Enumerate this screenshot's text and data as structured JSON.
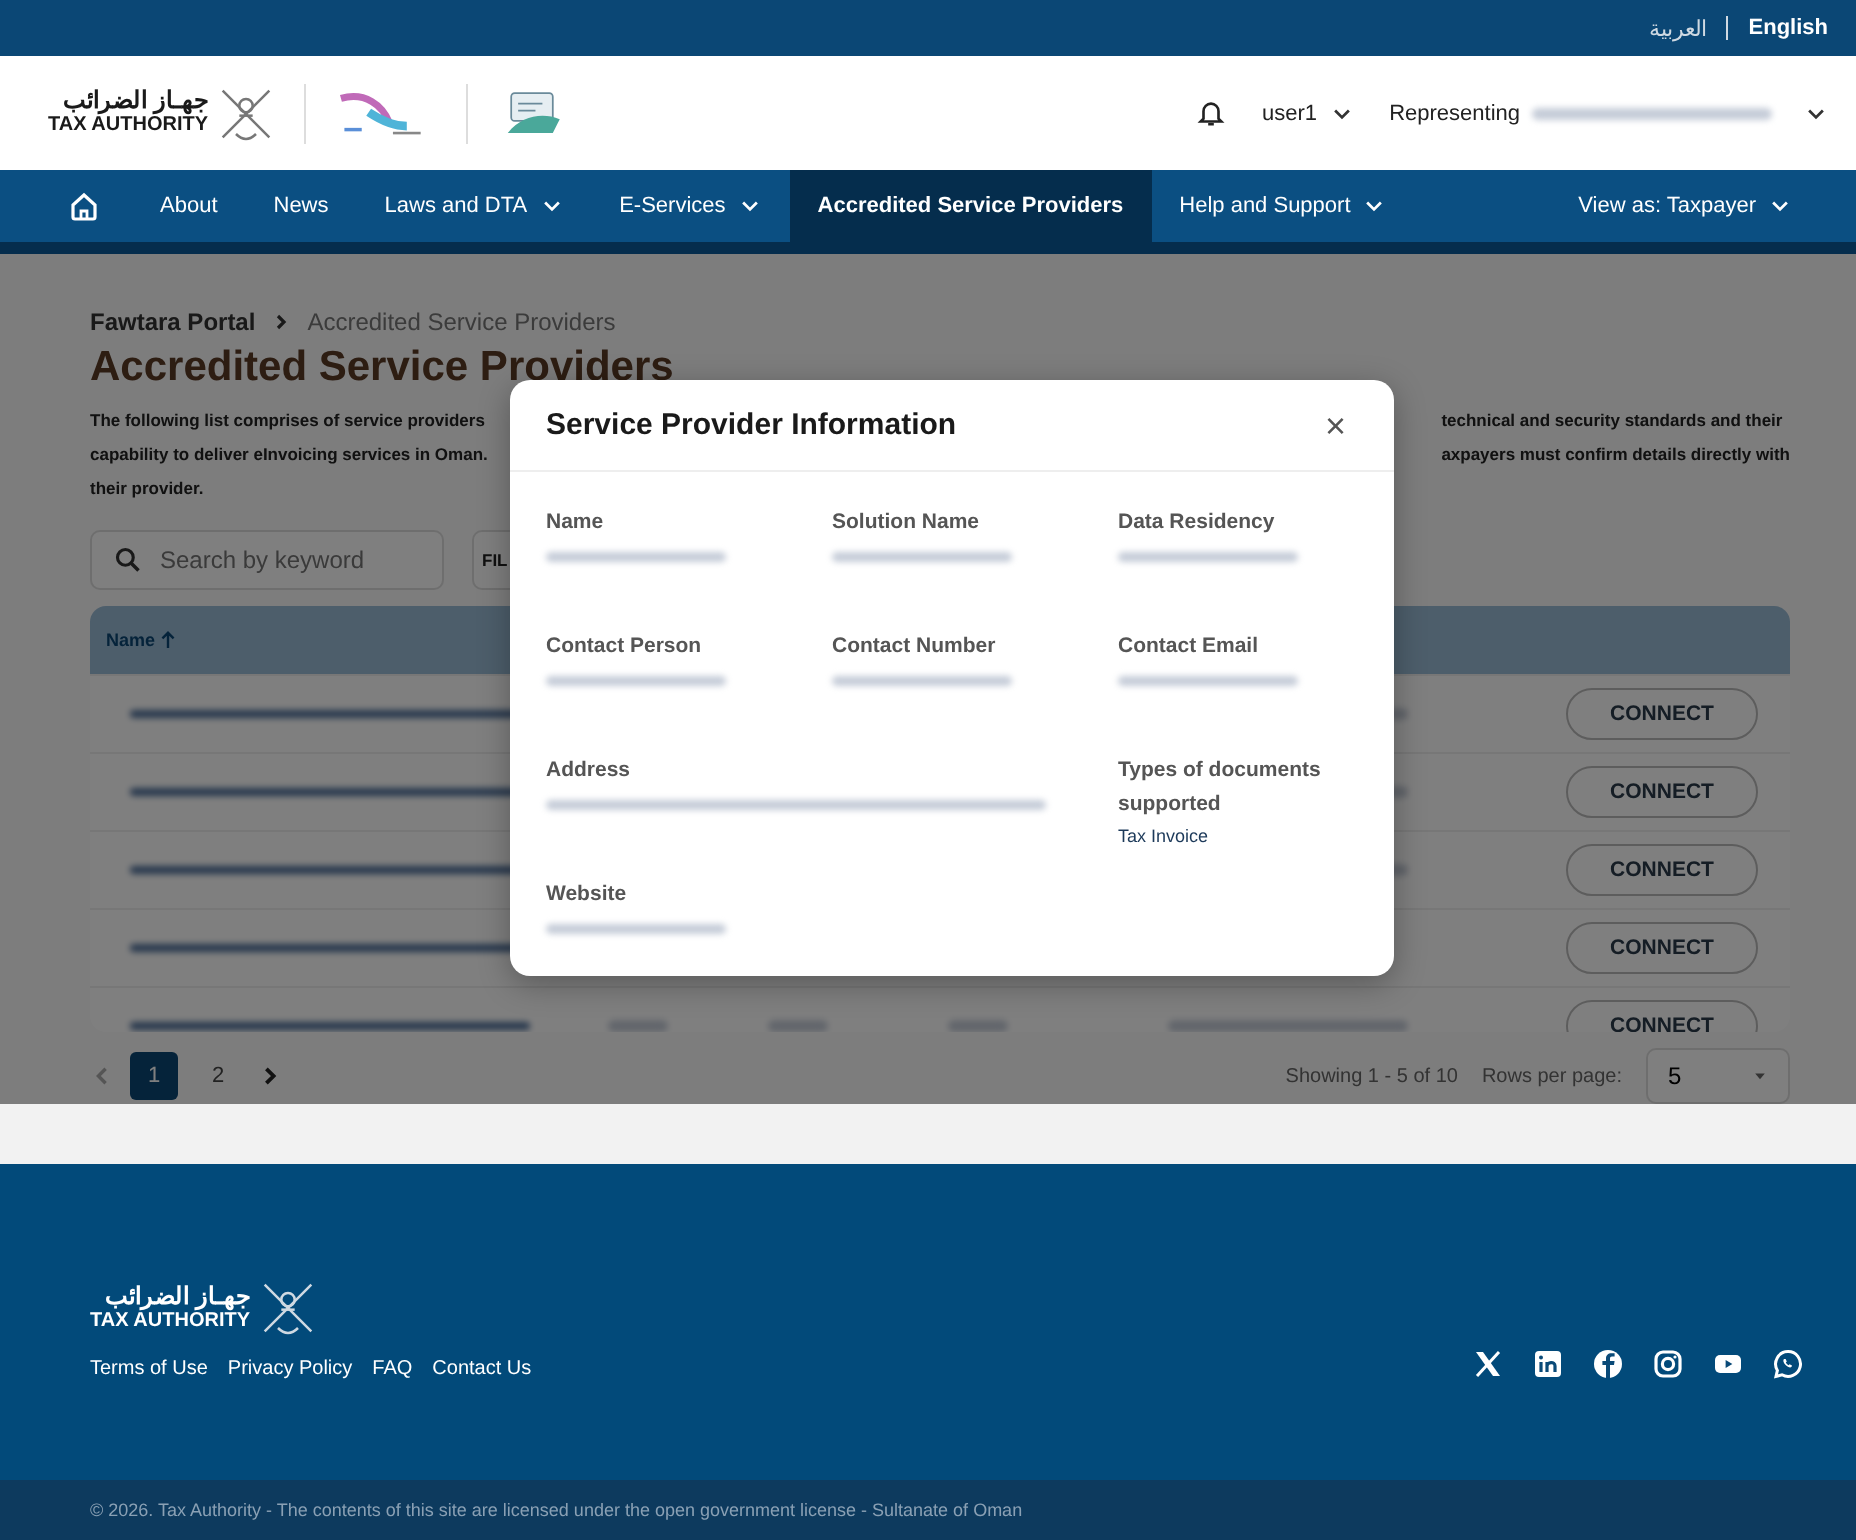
{
  "top_bar": {
    "languages": [
      {
        "label": "العربية",
        "selected": false
      },
      {
        "label": "English",
        "selected": true
      }
    ]
  },
  "header": {
    "logo": {
      "arabic": "جهـاز الضرائب",
      "english": "TAX AUTHORITY"
    },
    "user": "user1",
    "representing": {
      "label": "Representing",
      "value": {
        "kind": "redacted"
      }
    }
  },
  "nav": {
    "items": [
      {
        "kind": "home",
        "selected": false
      },
      {
        "kind": "link",
        "label": "About",
        "dropdown": false,
        "selected": false
      },
      {
        "kind": "link",
        "label": "News",
        "dropdown": false,
        "selected": false
      },
      {
        "kind": "link",
        "label": "Laws and DTA",
        "dropdown": true,
        "selected": false
      },
      {
        "kind": "link",
        "label": "E-Services",
        "dropdown": true,
        "selected": false
      },
      {
        "kind": "link",
        "label": "Accredited Service Providers",
        "dropdown": false,
        "selected": true
      },
      {
        "kind": "link",
        "label": "Help and Support",
        "dropdown": true,
        "selected": false
      }
    ],
    "view_as": "View as: Taxpayer"
  },
  "breadcrumb": [
    {
      "label": "Fawtara Portal"
    },
    {
      "label": "Accredited Service Providers"
    }
  ],
  "page_title": "Accredited Service Providers",
  "description": {
    "left_lines": [
      "The following list comprises of service providers",
      "capability to deliver eInvoicing services in Oman.",
      "their provider."
    ],
    "right_lines": [
      "technical and security standards and their",
      "axpayers must confirm details directly with"
    ]
  },
  "search": {
    "placeholder": "Search by keyword"
  },
  "filter_button": "FIL",
  "table": {
    "columns": [
      {
        "label": "Name",
        "sorted": true
      }
    ],
    "rows": [
      {
        "cells": [
          {
            "kind": "redacted"
          },
          {
            "kind": "empty"
          },
          {
            "kind": "empty"
          },
          {
            "kind": "empty"
          },
          {
            "kind": "redacted"
          }
        ],
        "button": "CONNECT"
      },
      {
        "cells": [
          {
            "kind": "redacted"
          },
          {
            "kind": "empty"
          },
          {
            "kind": "empty"
          },
          {
            "kind": "empty"
          },
          {
            "kind": "redacted"
          }
        ],
        "button": "CONNECT"
      },
      {
        "cells": [
          {
            "kind": "redacted"
          },
          {
            "kind": "empty"
          },
          {
            "kind": "empty"
          },
          {
            "kind": "empty"
          },
          {
            "kind": "redacted"
          }
        ],
        "button": "CONNECT"
      },
      {
        "cells": [
          {
            "kind": "redacted"
          },
          {
            "kind": "empty"
          },
          {
            "kind": "empty"
          },
          {
            "kind": "empty"
          },
          {
            "kind": "empty"
          }
        ],
        "button": "CONNECT"
      },
      {
        "cells": [
          {
            "kind": "redacted"
          },
          {
            "kind": "redacted"
          },
          {
            "kind": "redacted"
          },
          {
            "kind": "redacted"
          },
          {
            "kind": "redacted"
          }
        ],
        "button": "CONNECT"
      }
    ]
  },
  "pagination": {
    "pages": [
      {
        "label": "1",
        "selected": true
      },
      {
        "label": "2",
        "selected": false
      }
    ],
    "summary": "Showing 1 - 5 of 10",
    "rows_label": "Rows per page:",
    "rows_value": "5"
  },
  "modal": {
    "title": "Service Provider Information",
    "close": "×",
    "rows": [
      [
        {
          "label": "Name",
          "value": {
            "kind": "redacted"
          }
        },
        {
          "label": "Solution Name",
          "value": {
            "kind": "redacted"
          }
        },
        {
          "label": "Data Residency",
          "value": {
            "kind": "redacted"
          }
        }
      ],
      [
        {
          "label": "Contact Person",
          "value": {
            "kind": "redacted"
          }
        },
        {
          "label": "Contact Number",
          "value": {
            "kind": "redacted"
          }
        },
        {
          "label": "Contact Email",
          "value": {
            "kind": "redacted"
          }
        }
      ],
      [
        {
          "label": "Address",
          "value": {
            "kind": "redacted"
          }
        },
        "",
        {
          "label": "Types of documents supported",
          "value": {
            "kind": "text",
            "text": "Tax Invoice"
          }
        }
      ],
      [
        {
          "label": "Website",
          "value": {
            "kind": "redacted"
          }
        }
      ]
    ]
  },
  "footer": {
    "logo": {
      "arabic": "جهـاز الضرائب",
      "english": "TAX AUTHORITY"
    },
    "links": [
      "Terms of Use",
      "Privacy Policy",
      "FAQ",
      "Contact Us"
    ],
    "social": [
      {
        "kind": "x"
      },
      {
        "kind": "linkedin"
      },
      {
        "kind": "facebook"
      },
      {
        "kind": "instagram"
      },
      {
        "kind": "youtube"
      },
      {
        "kind": "whatsapp"
      }
    ],
    "copyright": "© 2026. Tax Authority - The contents of this site are licensed under the open government license - Sultanate of Oman"
  }
}
